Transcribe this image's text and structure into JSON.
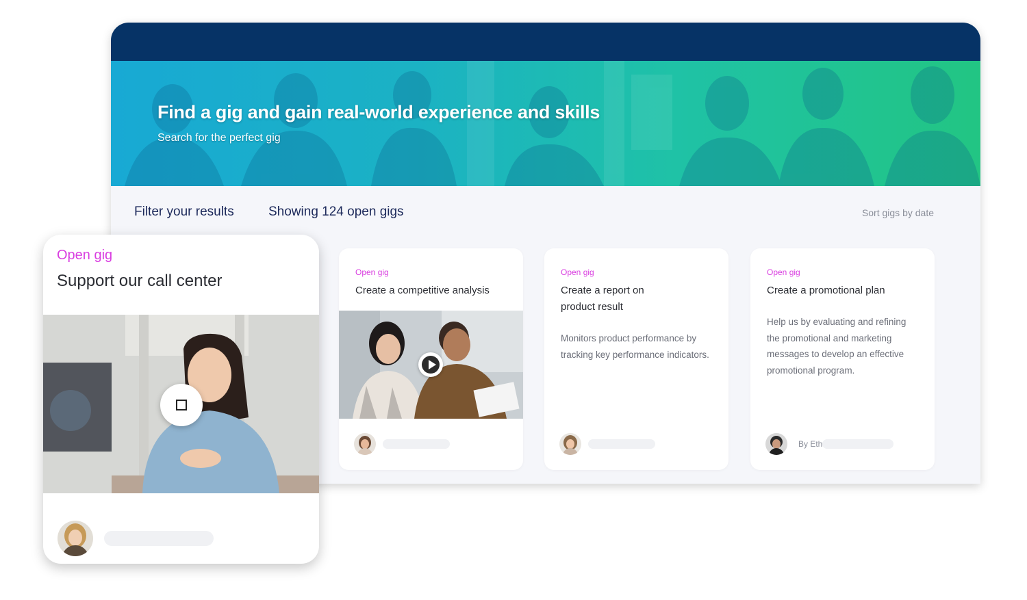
{
  "hero": {
    "title": "Find a gig and gain real-world experience and skills",
    "subtitle": "Search for the perfect gig"
  },
  "toolbar": {
    "filter_label": "Filter your results",
    "showing_label": "Showing 124 open gigs",
    "sort_label": "Sort gigs by date"
  },
  "cards": [
    {
      "tag": "Open gig",
      "title": "Create a competitive analysis",
      "media": "video-thumbnail",
      "icon": "play-icon"
    },
    {
      "tag": "Open gig",
      "title": "Create a report on product result",
      "description": "Monitors product performance by tracking key performance indicators."
    },
    {
      "tag": "Open gig",
      "title": "Create a promotional plan",
      "description": "Help us by evaluating and refining the promotional and marketing messages to develop an effective promotional program.",
      "author": "By Eth"
    }
  ],
  "float_card": {
    "tag": "Open gig",
    "title": "Support our call center",
    "icon": "stop-icon"
  },
  "colors": {
    "topbar": "#063366",
    "accent_pink": "#d93ee0",
    "heading_navy": "#1d2a5b",
    "hero_start": "#18a9d4",
    "hero_end": "#22c583"
  }
}
